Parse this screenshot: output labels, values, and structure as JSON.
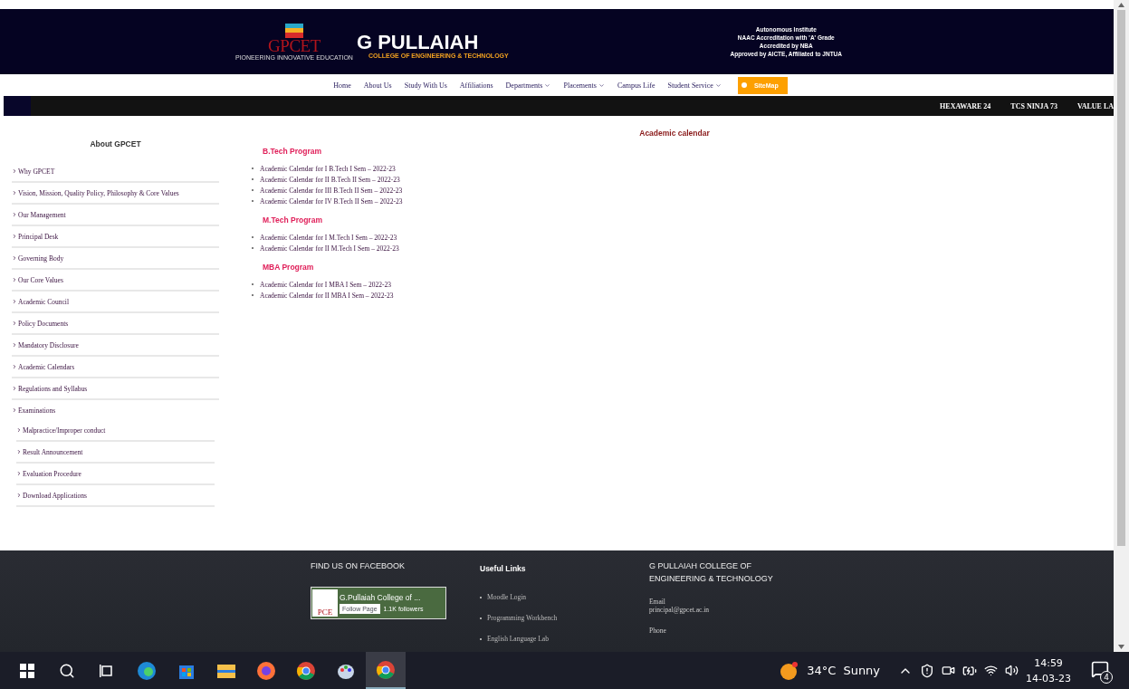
{
  "header": {
    "logo_text": "GPCET",
    "logo_tagline": "PIONEERING INNOVATIVE EDUCATION",
    "brand_title": "G PULLAIAH",
    "brand_subtitle": "COLLEGE OF ENGINEERING & TECHNOLOGY",
    "accreditation": [
      "Autonomous Institute",
      "NAAC Accreditation with 'A' Grade",
      "Accredited by NBA",
      "Approved by AICTE, Affiliated to JNTUA"
    ]
  },
  "nav": {
    "items": [
      {
        "label": "Home",
        "dropdown": false
      },
      {
        "label": "About Us",
        "dropdown": false
      },
      {
        "label": "Study With Us",
        "dropdown": false
      },
      {
        "label": "Affiliations",
        "dropdown": false
      },
      {
        "label": "Departments",
        "dropdown": true
      },
      {
        "label": "Placements",
        "dropdown": true
      },
      {
        "label": "Campus Life",
        "dropdown": false
      },
      {
        "label": "Student Service",
        "dropdown": true
      }
    ],
    "sitemap_button": "SiteMap"
  },
  "ticker": {
    "items": [
      "HEXAWARE 24",
      "TCS NINJA 73",
      "VALUE LA"
    ]
  },
  "sidebar": {
    "title": "About GPCET",
    "items": [
      {
        "label": "Why GPCET"
      },
      {
        "label": "Vision, Mission, Quality Policy, Philosophy & Core Values"
      },
      {
        "label": "Our Management"
      },
      {
        "label": "Principal Desk"
      },
      {
        "label": "Governing Body"
      },
      {
        "label": "Our Core Values"
      },
      {
        "label": "Academic Council"
      },
      {
        "label": "Policy Documents"
      },
      {
        "label": "Mandatory Disclosure"
      },
      {
        "label": "Academic Calendars"
      },
      {
        "label": "Regulations and Syllabus"
      },
      {
        "label": "Examinations",
        "children": [
          {
            "label": "Malpractice/Improper conduct"
          },
          {
            "label": "Result Announcement"
          },
          {
            "label": "Evaluation Procedure"
          },
          {
            "label": "Download Applications"
          }
        ]
      }
    ]
  },
  "content": {
    "title": "Academic calendar",
    "sections": [
      {
        "heading": "B.Tech Program",
        "links": [
          "Academic Calendar for I B.Tech I Sem – 2022-23",
          "Academic Calendar for II B.Tech II Sem – 2022-23",
          "Academic Calendar for III B.Tech II Sem – 2022-23",
          "Academic Calendar for IV B.Tech II Sem – 2022-23"
        ]
      },
      {
        "heading": "M.Tech Program",
        "links": [
          "Academic Calendar for I M.Tech I Sem – 2022-23",
          "Academic Calendar for II M.Tech I Sem – 2022-23"
        ]
      },
      {
        "heading": "MBA Program",
        "links": [
          "Academic Calendar for I MBA I Sem – 2022-23",
          "Academic Calendar for II MBA I Sem – 2022-23"
        ]
      }
    ]
  },
  "footer": {
    "facebook": {
      "heading": "FIND US ON FACEBOOK",
      "page_name": "G.Pullaiah College of ...",
      "logo_text": "PCE",
      "follow_button": "Follow Page",
      "followers": "1.1K followers"
    },
    "useful_links": {
      "heading": "Useful Links",
      "links": [
        "Moodle Login",
        "Programming Workbench",
        "English Language Lab"
      ]
    },
    "contact": {
      "heading": "G PULLAIAH COLLEGE OF ENGINEERING & TECHNOLOGY",
      "fields": [
        {
          "label": "Email",
          "value": "principal@gpcet.ac.in"
        },
        {
          "label": "Phone"
        }
      ]
    }
  },
  "taskbar": {
    "apps": [
      {
        "kind": "edge",
        "selected": false
      },
      {
        "kind": "store",
        "selected": false
      },
      {
        "kind": "files",
        "selected": false
      },
      {
        "kind": "firefox",
        "selected": false
      },
      {
        "kind": "chrome",
        "selected": false
      },
      {
        "kind": "paint",
        "selected": false
      },
      {
        "kind": "chrome",
        "selected": true
      }
    ],
    "weather": {
      "temperature": "34°C",
      "condition": "Sunny"
    },
    "time": "14:59",
    "date": "14-03-23",
    "notifications": "4"
  }
}
